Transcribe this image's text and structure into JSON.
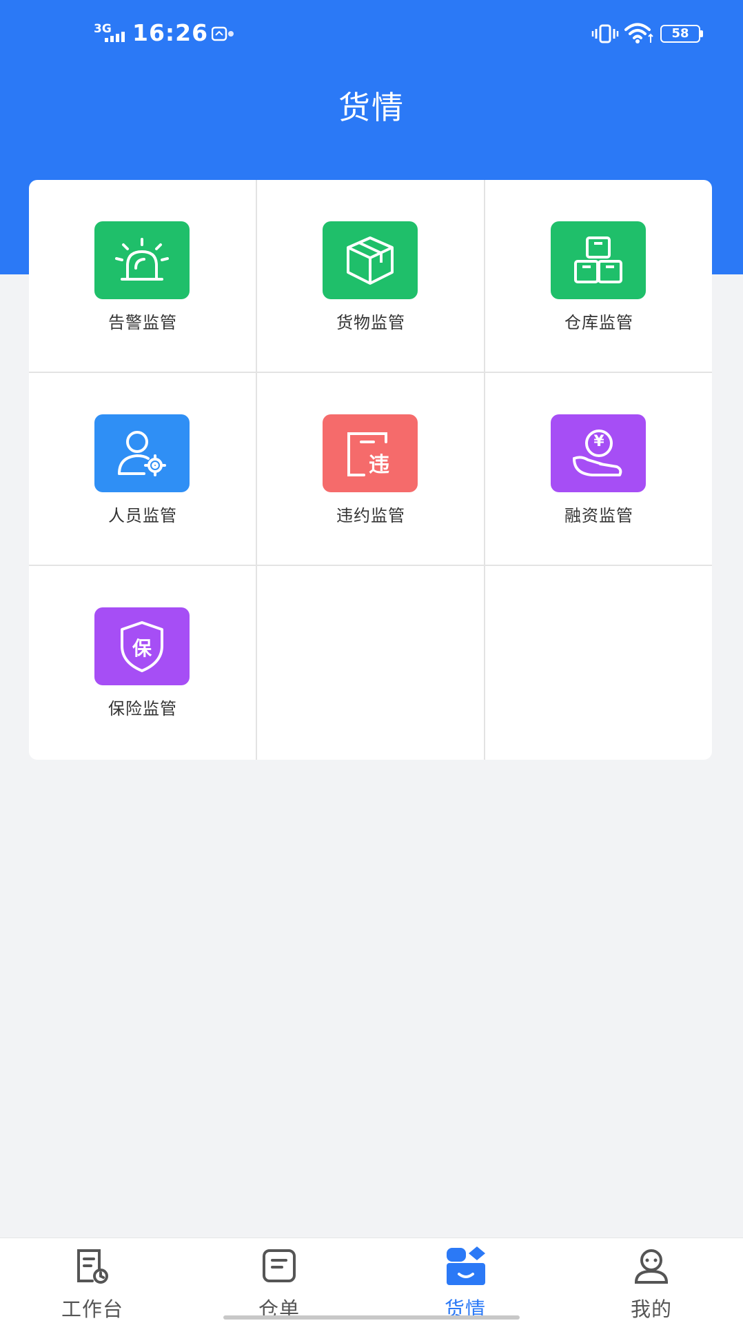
{
  "status_bar": {
    "network": "3G",
    "time": "16:26",
    "battery": "58"
  },
  "header": {
    "title": "货情"
  },
  "grid": {
    "items": [
      {
        "label": "告警监管",
        "icon": "alarm-light-icon",
        "color": "#1fbf6a"
      },
      {
        "label": "货物监管",
        "icon": "box-icon",
        "color": "#1fbf6a"
      },
      {
        "label": "仓库监管",
        "icon": "warehouse-boxes-icon",
        "color": "#1fbf6a"
      },
      {
        "label": "人员监管",
        "icon": "person-gear-icon",
        "color": "#2f8ff5"
      },
      {
        "label": "违约监管",
        "icon": "violation-icon",
        "color": "#f56b6b",
        "glyph": "违"
      },
      {
        "label": "融资监管",
        "icon": "yen-hand-icon",
        "color": "#a64ef5",
        "glyph": "¥"
      },
      {
        "label": "保险监管",
        "icon": "insurance-shield-icon",
        "color": "#a64ef5",
        "glyph": "保"
      }
    ]
  },
  "tab_bar": {
    "items": [
      {
        "label": "工作台",
        "icon": "workbench-doc-icon",
        "active": false
      },
      {
        "label": "仓单",
        "icon": "receipt-icon",
        "active": false
      },
      {
        "label": "货情",
        "icon": "cargo-status-icon",
        "active": true
      },
      {
        "label": "我的",
        "icon": "profile-icon",
        "active": false
      }
    ],
    "active_color": "#2b79f6",
    "inactive_color": "#555555"
  },
  "colors": {
    "header": "#2b79f6",
    "background": "#f2f3f5"
  }
}
